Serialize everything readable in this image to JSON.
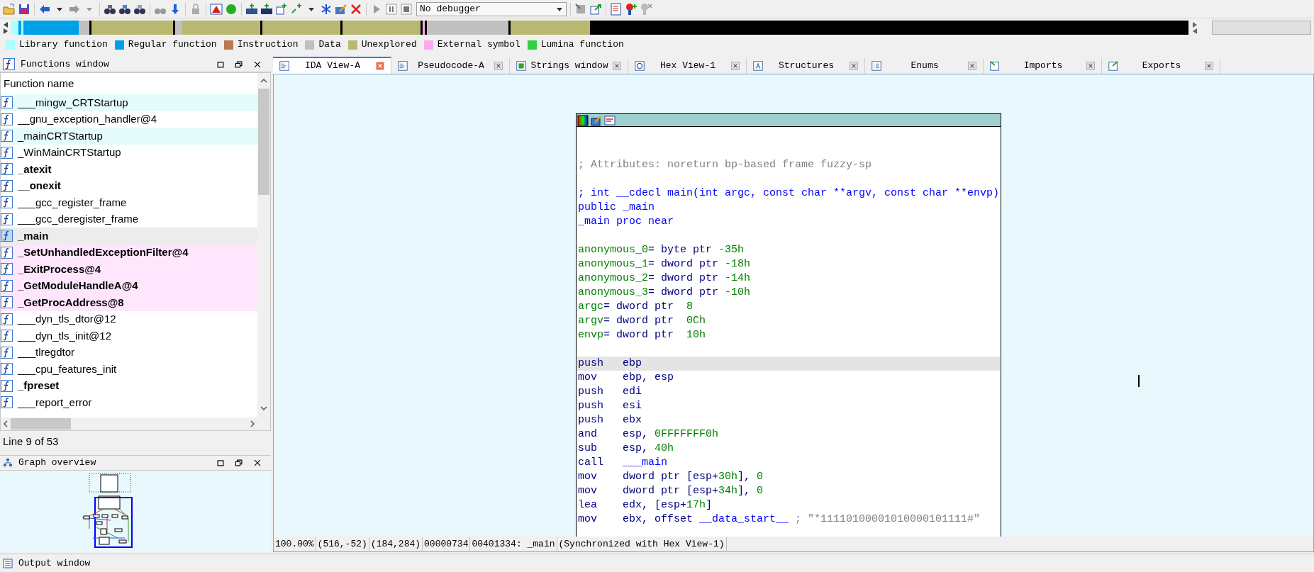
{
  "toolbar": {
    "debugger_select": "No debugger"
  },
  "legend": [
    {
      "label": "Library function",
      "color": "#aaffff"
    },
    {
      "label": "Regular function",
      "color": "#00a0e8"
    },
    {
      "label": "Instruction",
      "color": "#b87850"
    },
    {
      "label": "Data",
      "color": "#c0c0c0"
    },
    {
      "label": "Unexplored",
      "color": "#b8b870"
    },
    {
      "label": "External symbol",
      "color": "#ffa8f0"
    },
    {
      "label": "Lumina function",
      "color": "#30d040"
    }
  ],
  "functions_window": {
    "title": "Functions window",
    "column": "Function name",
    "status": "Line 9 of 53",
    "rows": [
      {
        "name": "___mingw_CRTStartup",
        "kind": "library",
        "bold": false,
        "selected": false
      },
      {
        "name": "__gnu_exception_handler@4",
        "kind": "regular",
        "bold": false,
        "selected": false
      },
      {
        "name": "_mainCRTStartup",
        "kind": "library",
        "bold": false,
        "selected": false
      },
      {
        "name": "_WinMainCRTStartup",
        "kind": "regular",
        "bold": false,
        "selected": false
      },
      {
        "name": "_atexit",
        "kind": "regular",
        "bold": true,
        "selected": false
      },
      {
        "name": "__onexit",
        "kind": "regular",
        "bold": true,
        "selected": false
      },
      {
        "name": "___gcc_register_frame",
        "kind": "regular",
        "bold": false,
        "selected": false
      },
      {
        "name": "___gcc_deregister_frame",
        "kind": "regular",
        "bold": false,
        "selected": false
      },
      {
        "name": "_main",
        "kind": "regular",
        "bold": true,
        "selected": true
      },
      {
        "name": "_SetUnhandledExceptionFilter@4",
        "kind": "external",
        "bold": true,
        "selected": false
      },
      {
        "name": "_ExitProcess@4",
        "kind": "external",
        "bold": true,
        "selected": false
      },
      {
        "name": "_GetModuleHandleA@4",
        "kind": "external",
        "bold": true,
        "selected": false
      },
      {
        "name": "_GetProcAddress@8",
        "kind": "external",
        "bold": true,
        "selected": false
      },
      {
        "name": "___dyn_tls_dtor@12",
        "kind": "regular",
        "bold": false,
        "selected": false
      },
      {
        "name": "___dyn_tls_init@12",
        "kind": "regular",
        "bold": false,
        "selected": false
      },
      {
        "name": "___tlregdtor",
        "kind": "regular",
        "bold": false,
        "selected": false
      },
      {
        "name": "___cpu_features_init",
        "kind": "regular",
        "bold": false,
        "selected": false
      },
      {
        "name": "_fpreset",
        "kind": "regular",
        "bold": true,
        "selected": false
      },
      {
        "name": "___report_error",
        "kind": "regular",
        "bold": false,
        "selected": false
      }
    ]
  },
  "graph_overview": {
    "title": "Graph overview"
  },
  "tabs": [
    {
      "label": "IDA View-A",
      "selected": true
    },
    {
      "label": "Pseudocode-A",
      "selected": false
    },
    {
      "label": "Strings window",
      "selected": false
    },
    {
      "label": "Hex View-1",
      "selected": false
    },
    {
      "label": "Structures",
      "selected": false
    },
    {
      "label": "Enums",
      "selected": false
    },
    {
      "label": "Imports",
      "selected": false
    },
    {
      "label": "Exports",
      "selected": false
    }
  ],
  "code_blocks": [
    [
      {
        "parts": [
          {
            "text": "; Attributes: noreturn bp-based frame fuzzy-sp",
            "kind": "comment"
          }
        ],
        "selected": false
      }
    ],
    [
      {
        "parts": [
          {
            "text": "; int __cdecl main(int argc, const char **argv, const char **envp)",
            "kind": "keyword"
          }
        ],
        "selected": false
      },
      {
        "parts": [
          {
            "text": "public _main",
            "kind": "keyword"
          }
        ],
        "selected": false
      },
      {
        "parts": [
          {
            "text": "_main proc near",
            "kind": "keyword"
          }
        ],
        "selected": false
      }
    ],
    [
      {
        "parts": [
          {
            "text": "anonymous_0",
            "kind": "name"
          },
          {
            "text": "= byte ptr ",
            "kind": "plain"
          },
          {
            "text": "-35h",
            "kind": "name"
          }
        ],
        "selected": false
      },
      {
        "parts": [
          {
            "text": "anonymous_1",
            "kind": "name"
          },
          {
            "text": "= dword ptr ",
            "kind": "plain"
          },
          {
            "text": "-18h",
            "kind": "name"
          }
        ],
        "selected": false
      },
      {
        "parts": [
          {
            "text": "anonymous_2",
            "kind": "name"
          },
          {
            "text": "= dword ptr ",
            "kind": "plain"
          },
          {
            "text": "-14h",
            "kind": "name"
          }
        ],
        "selected": false
      },
      {
        "parts": [
          {
            "text": "anonymous_3",
            "kind": "name"
          },
          {
            "text": "= dword ptr ",
            "kind": "plain"
          },
          {
            "text": "-10h",
            "kind": "name"
          }
        ],
        "selected": false
      },
      {
        "parts": [
          {
            "text": "argc",
            "kind": "name"
          },
          {
            "text": "= dword ptr  ",
            "kind": "plain"
          },
          {
            "text": "8",
            "kind": "name"
          }
        ],
        "selected": false
      },
      {
        "parts": [
          {
            "text": "argv",
            "kind": "name"
          },
          {
            "text": "= dword ptr  ",
            "kind": "plain"
          },
          {
            "text": "0Ch",
            "kind": "name"
          }
        ],
        "selected": false
      },
      {
        "parts": [
          {
            "text": "envp",
            "kind": "name"
          },
          {
            "text": "= dword ptr  ",
            "kind": "plain"
          },
          {
            "text": "10h",
            "kind": "name"
          }
        ],
        "selected": false
      }
    ],
    [
      {
        "mnemonic": "push",
        "parts": [
          {
            "text": "ebp",
            "kind": "plain"
          }
        ],
        "selected": true
      },
      {
        "mnemonic": "mov",
        "parts": [
          {
            "text": "ebp, esp",
            "kind": "plain"
          }
        ],
        "selected": false
      },
      {
        "mnemonic": "push",
        "parts": [
          {
            "text": "edi",
            "kind": "plain"
          }
        ],
        "selected": false
      },
      {
        "mnemonic": "push",
        "parts": [
          {
            "text": "esi",
            "kind": "plain"
          }
        ],
        "selected": false
      },
      {
        "mnemonic": "push",
        "parts": [
          {
            "text": "ebx",
            "kind": "plain"
          }
        ],
        "selected": false
      },
      {
        "mnemonic": "and",
        "parts": [
          {
            "text": "esp, ",
            "kind": "plain"
          },
          {
            "text": "0FFFFFFF0h",
            "kind": "name"
          }
        ],
        "selected": false
      },
      {
        "mnemonic": "sub",
        "parts": [
          {
            "text": "esp, ",
            "kind": "plain"
          },
          {
            "text": "40h",
            "kind": "name"
          }
        ],
        "selected": false
      },
      {
        "mnemonic": "call",
        "parts": [
          {
            "text": "___main",
            "kind": "keyword"
          }
        ],
        "selected": false
      },
      {
        "mnemonic": "mov",
        "parts": [
          {
            "text": "dword ptr [esp+",
            "kind": "plain"
          },
          {
            "text": "30h",
            "kind": "name"
          },
          {
            "text": "], ",
            "kind": "plain"
          },
          {
            "text": "0",
            "kind": "name"
          }
        ],
        "selected": false
      },
      {
        "mnemonic": "mov",
        "parts": [
          {
            "text": "dword ptr [esp+",
            "kind": "plain"
          },
          {
            "text": "34h",
            "kind": "name"
          },
          {
            "text": "], ",
            "kind": "plain"
          },
          {
            "text": "0",
            "kind": "name"
          }
        ],
        "selected": false
      },
      {
        "mnemonic": "lea",
        "parts": [
          {
            "text": "edx, [esp+",
            "kind": "plain"
          },
          {
            "text": "17h",
            "kind": "name"
          },
          {
            "text": "]",
            "kind": "plain"
          }
        ],
        "selected": false
      },
      {
        "mnemonic": "mov",
        "parts": [
          {
            "text": "ebx, offset ",
            "kind": "plain"
          },
          {
            "text": "__data_start__",
            "kind": "keyword"
          },
          {
            "text": " ; \"*11110100001010000101111#\"",
            "kind": "comment"
          }
        ],
        "selected": false
      }
    ]
  ],
  "status_bar": [
    "100.00%",
    "(516,-52)",
    "(184,284)",
    "00000734",
    "00401334: _main",
    "(Synchronized with Hex View-1)"
  ],
  "output_window": {
    "title": "Output window"
  }
}
